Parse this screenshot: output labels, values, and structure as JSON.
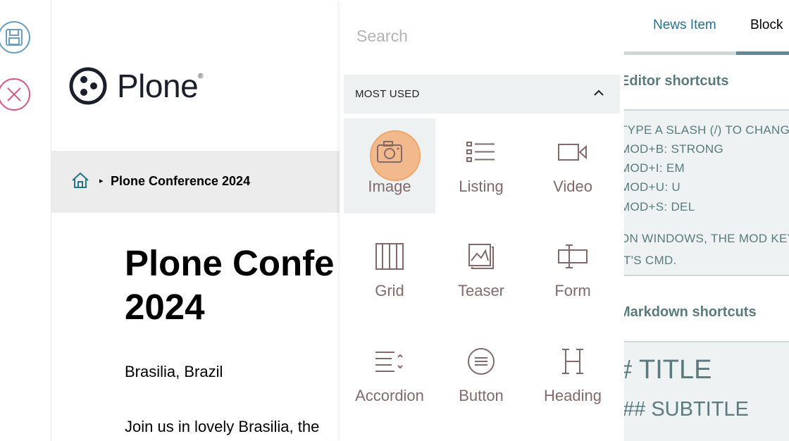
{
  "toolbar": {
    "save_icon": "save-icon",
    "cancel_icon": "close-icon"
  },
  "logo": {
    "text": "Plone",
    "reg": "®"
  },
  "breadcrumb": {
    "home_icon": "home-icon",
    "separator": "▸",
    "item": "Plone Conference 2024"
  },
  "page": {
    "title": "Plone Confe\n2024",
    "location": "Brasilia, Brazil",
    "intro": "Join us in lovely Brasilia, the"
  },
  "chooser": {
    "search_placeholder": "Search",
    "section_label": "MOST USED",
    "blocks": [
      {
        "label": "Image",
        "icon": "camera-icon"
      },
      {
        "label": "Listing",
        "icon": "list-icon"
      },
      {
        "label": "Video",
        "icon": "video-icon"
      },
      {
        "label": "Grid",
        "icon": "grid-icon"
      },
      {
        "label": "Teaser",
        "icon": "teaser-icon"
      },
      {
        "label": "Form",
        "icon": "form-icon"
      },
      {
        "label": "Accordion",
        "icon": "accordion-icon"
      },
      {
        "label": "Button",
        "icon": "button-icon"
      },
      {
        "label": "Heading",
        "icon": "heading-icon"
      }
    ]
  },
  "sidebar": {
    "tabs": {
      "news": "News Item",
      "block": "Block"
    },
    "editor_title": "Editor shortcuts",
    "editor_lines": [
      "TYPE A SLASH (/) TO CHANGE",
      "MOD+B: STRONG",
      "MOD+I: EM",
      "MOD+U: U",
      "MOD+S: DEL",
      "ON WINDOWS, THE MOD KEY",
      "IT'S CMD."
    ],
    "markdown_title": "Markdown shortcuts",
    "md_h1": "# TITLE",
    "md_h2": "## SUBTITLE"
  },
  "colors": {
    "accent": "#25738f",
    "block_label": "#826a6a",
    "highlight": "#f4b07c",
    "panel": "#edf1f2"
  }
}
